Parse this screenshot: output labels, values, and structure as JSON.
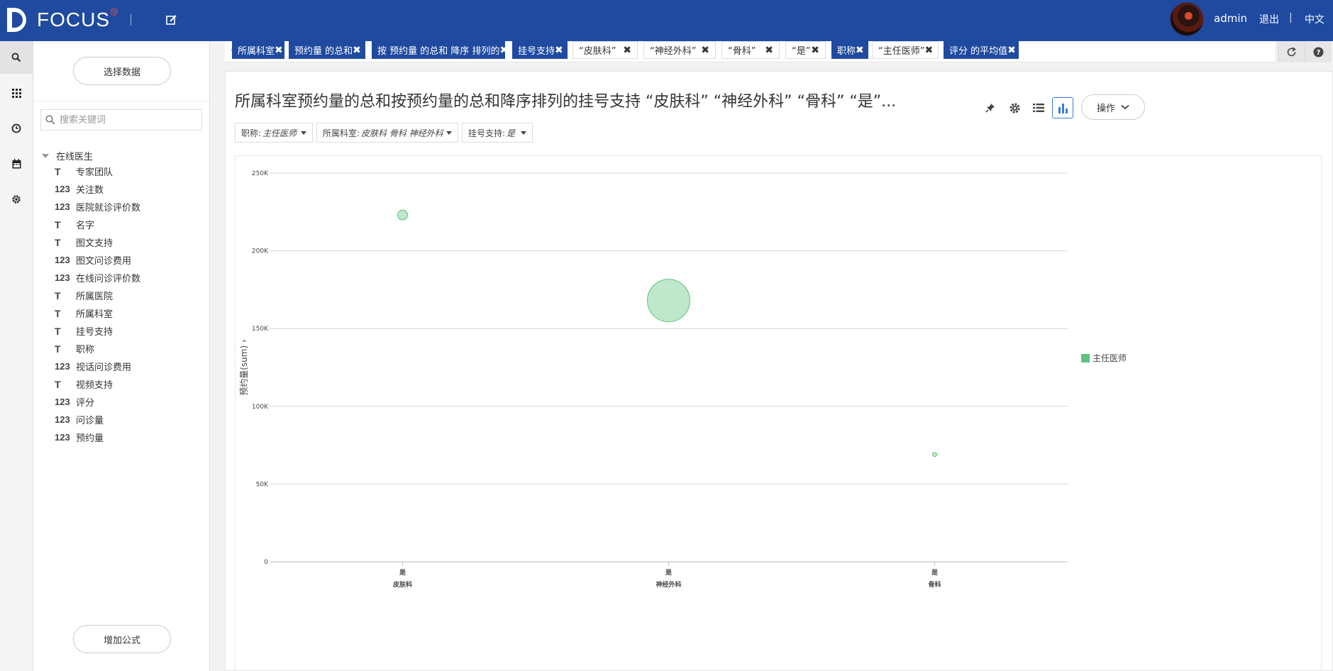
{
  "app": {
    "logo_text": "FOCUS",
    "logo_sup": "@",
    "user": "admin",
    "logout": "退出",
    "separator": "|",
    "language": "中文"
  },
  "panel": {
    "select_data": "选择数据",
    "search_placeholder": "搜索关键词",
    "tree_root": "在线医生",
    "fields": [
      {
        "type": "text",
        "type_label": "T",
        "name": "专家团队"
      },
      {
        "type": "num",
        "type_label": "123",
        "name": "关注数"
      },
      {
        "type": "num",
        "type_label": "123",
        "name": "医院就诊评价数"
      },
      {
        "type": "text",
        "type_label": "T",
        "name": "名字"
      },
      {
        "type": "text",
        "type_label": "T",
        "name": "图文支持"
      },
      {
        "type": "num",
        "type_label": "123",
        "name": "图文问诊费用"
      },
      {
        "type": "num",
        "type_label": "123",
        "name": "在线问诊评价数"
      },
      {
        "type": "text",
        "type_label": "T",
        "name": "所属医院"
      },
      {
        "type": "text",
        "type_label": "T",
        "name": "所属科室"
      },
      {
        "type": "text",
        "type_label": "T",
        "name": "挂号支持"
      },
      {
        "type": "text",
        "type_label": "T",
        "name": "职称"
      },
      {
        "type": "num",
        "type_label": "123",
        "name": "视话问诊费用"
      },
      {
        "type": "text",
        "type_label": "T",
        "name": "视频支持"
      },
      {
        "type": "num",
        "type_label": "123",
        "name": "评分"
      },
      {
        "type": "num",
        "type_label": "123",
        "name": "问诊量"
      },
      {
        "type": "num",
        "type_label": "123",
        "name": "预约量"
      }
    ],
    "add_formula": "增加公式"
  },
  "query_chips": [
    {
      "label": "所属科室",
      "style": "blue"
    },
    {
      "label": "预约量 的总和",
      "style": "blue"
    },
    {
      "label": "按 预约量 的总和 降序 排列的",
      "style": "blue"
    },
    {
      "label": "挂号支持",
      "style": "blue"
    },
    {
      "label": "“皮肤科”",
      "style": "white"
    },
    {
      "label": "“神经外科”",
      "style": "white"
    },
    {
      "label": "“骨科”",
      "style": "white"
    },
    {
      "label": "“是”",
      "style": "white"
    },
    {
      "label": "职称",
      "style": "blue"
    },
    {
      "label": "“主任医师”",
      "style": "white"
    },
    {
      "label": "评分 的平均值",
      "style": "blue"
    }
  ],
  "chip_close": "✖",
  "chart_card": {
    "title": "所属科室预约量的总和按预约量的总和降序排列的挂号支持 “皮肤科” “神经外科” “骨科” “是”...",
    "ops_label": "操作",
    "filters": [
      {
        "key": "职称:",
        "value": "主任医师"
      },
      {
        "key": "所属科室:",
        "value": "皮肤科  骨科  神经外科"
      },
      {
        "key": "挂号支持:",
        "value": "是"
      }
    ]
  },
  "chart_data": {
    "type": "scatter",
    "title": "",
    "xlabel": "",
    "ylabel": "预约量(sum)",
    "ylim": [
      0,
      250000
    ],
    "yticks": [
      0,
      50000,
      100000,
      150000,
      200000,
      250000
    ],
    "ytick_labels": [
      "0",
      "50K",
      "100K",
      "150K",
      "200K",
      "250K"
    ],
    "categories": [
      {
        "top": "是",
        "bottom": "皮肤科"
      },
      {
        "top": "是",
        "bottom": "神经外科"
      },
      {
        "top": "是",
        "bottom": "骨科"
      }
    ],
    "series": [
      {
        "name": "主任医师",
        "color": "#5fc27e",
        "points": [
          {
            "category": "皮肤科",
            "y": 223000,
            "bubble_size": "small"
          },
          {
            "category": "神经外科",
            "y": 168000,
            "bubble_size": "large"
          },
          {
            "category": "骨科",
            "y": 69000,
            "bubble_size": "tiny"
          }
        ]
      }
    ],
    "grid": true,
    "legend_position": "right"
  }
}
